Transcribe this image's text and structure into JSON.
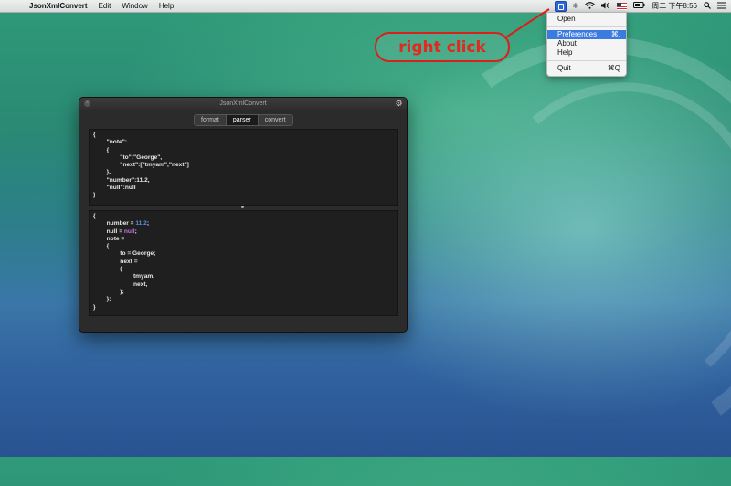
{
  "menubar": {
    "app_name": "JsonXmlConvert",
    "menus": [
      "Edit",
      "Window",
      "Help"
    ],
    "status_time": "周二 下午8:56"
  },
  "tray_menu": {
    "items": [
      {
        "label": "Open",
        "shortcut": ""
      },
      {
        "label": "Preferences",
        "shortcut": "⌘,"
      },
      {
        "label": "About",
        "shortcut": ""
      },
      {
        "label": "Help",
        "shortcut": ""
      },
      {
        "label": "Quit",
        "shortcut": "⌘Q"
      }
    ]
  },
  "annotation": {
    "text": "right click",
    "color": "#d8211c"
  },
  "window": {
    "title": "JsonXmlConvert",
    "tabs": [
      "format",
      "parser",
      "convert"
    ],
    "selected_tab": "parser",
    "input_json": "{\n        \"note\":\n        {\n                \"to\":\"George\",\n                \"next\":[\"tmyam\",\"next\"]\n        },\n        \"number\":11.2,\n        \"null\":null\n}",
    "output": {
      "line1_prefix": "{\n        number = ",
      "number_value": "11.2",
      "line1_suffix": ";\n        null = ",
      "null_value": "null",
      "rest": ";\n        note =\n        {\n                to = George;\n                next =\n                (\n                        tmyam,\n                        next,\n                );\n        };\n}"
    }
  },
  "colors": {
    "accent_blue": "#3b7be0",
    "number_color": "#5a8ff0",
    "null_color": "#d070e8"
  }
}
